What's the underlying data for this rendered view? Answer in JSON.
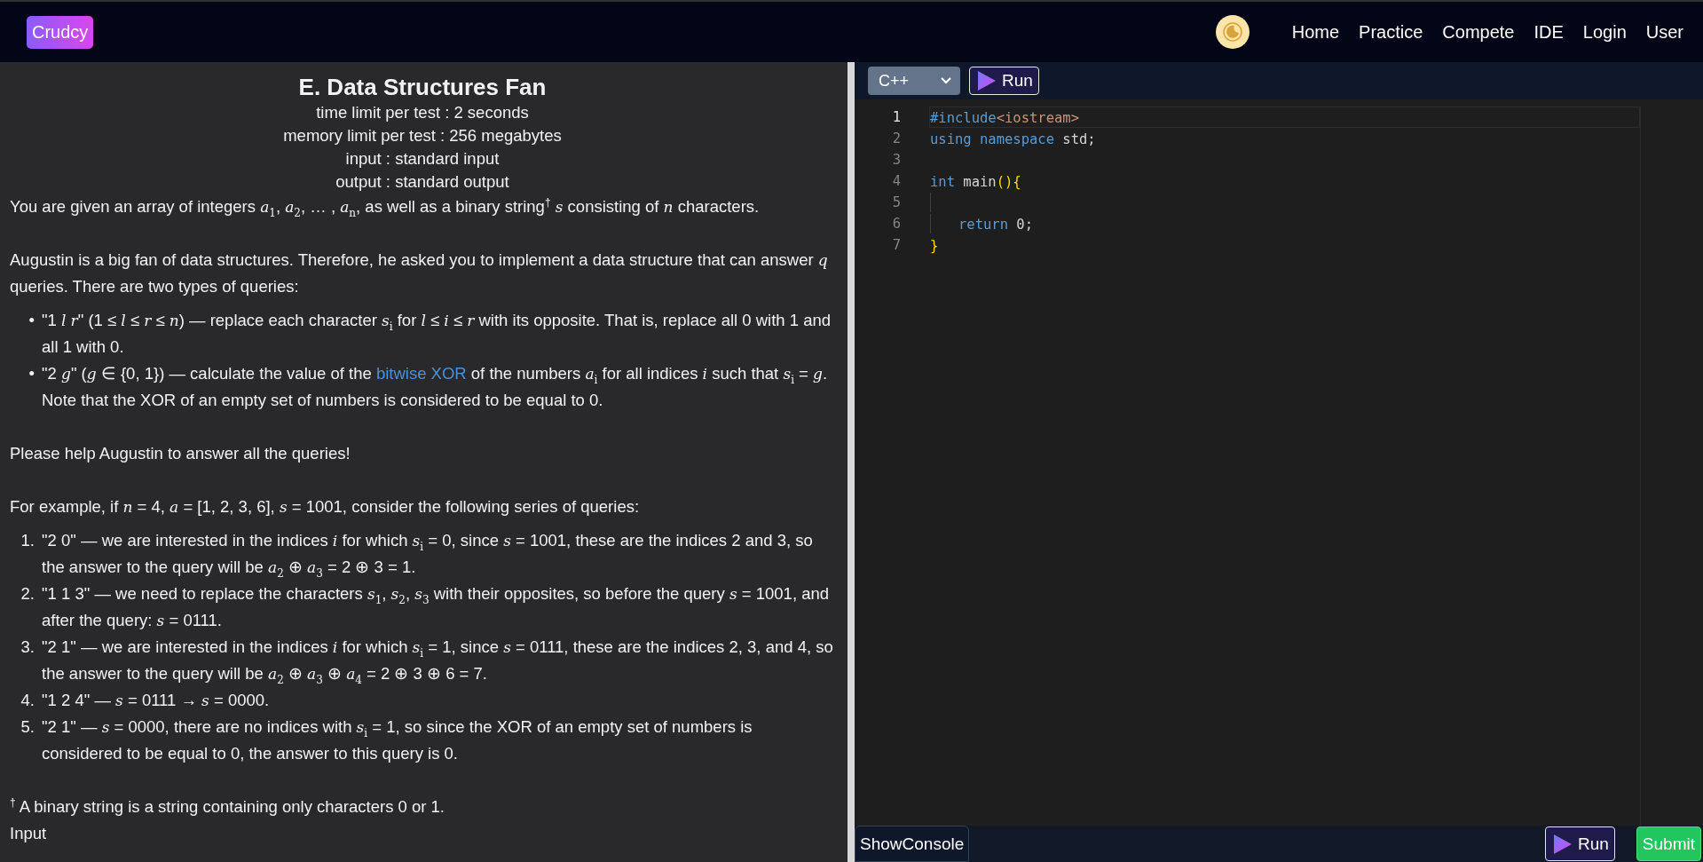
{
  "header": {
    "logo": "Crudcy",
    "nav": [
      {
        "label": "Home"
      },
      {
        "label": "Practice"
      },
      {
        "label": "Compete"
      },
      {
        "label": "IDE"
      },
      {
        "label": "Login"
      },
      {
        "label": "User"
      }
    ]
  },
  "problem": {
    "title": "E. Data Structures Fan",
    "limits": [
      "time limit per test : 2 seconds",
      "memory limit per test : 256 megabytes",
      "input : standard input",
      "output : standard output"
    ],
    "blocks": [
      {
        "kind": "paragraph",
        "parts": [
          {
            "text": "You are given an array of integers *a*$_{1}$, *a*$_{2}$,  … , *a*$_{n}$, as well as a binary string$^{†}$ *s* consisting of *n* characters."
          }
        ]
      },
      {
        "kind": "paragraph",
        "parts": [
          {
            "text": "Augustin is a big fan of data structures. Therefore, he asked you to implement a data structure that can answer *q* queries. There are two types of queries:"
          }
        ]
      },
      {
        "kind": "item",
        "marker": "•",
        "parts": [
          {
            "text": "\"1 *l* *r*\" (1 ≤ *l* ≤ *r* ≤ *n*) — replace each character *s*$_{i}$ for *l* ≤ *i* ≤ *r* with its opposite. That is, replace all 0 with 1 and all 1 with 0."
          }
        ]
      },
      {
        "kind": "item",
        "marker": "•",
        "parts": [
          {
            "text": "\"2 *g*\" (*g* ∈ {0, 1}) — calculate the value of the "
          },
          {
            "kind": "link",
            "text": "bitwise XOR"
          },
          {
            "text": " of the numbers *a*$_{i}$ for all indices *i* such that *s*$_{i}$ = *g*. Note that the XOR of an empty set of numbers is considered to be equal to 0."
          }
        ]
      },
      {
        "kind": "paragraph",
        "parts": [
          {
            "text": "Please help Augustin to answer all the queries!"
          }
        ]
      },
      {
        "kind": "paragraph",
        "parts": [
          {
            "text": "For example, if *n* = 4, *a* = [1, 2, 3, 6], *s* = 1001, consider the following series of queries:"
          }
        ]
      },
      {
        "kind": "item",
        "marker": "1.",
        "parts": [
          {
            "text": "\"2 0\" — we are interested in the indices *i* for which *s*$_{i}$ = 0, since *s* = 1001, these are the indices 2 and 3, so the answer to the query will be *a*$_{2}$ ⊕ *a*$_{3}$ = 2 ⊕ 3 = 1."
          }
        ]
      },
      {
        "kind": "item",
        "marker": "2.",
        "parts": [
          {
            "text": "\"1 1 3\" — we need to replace the characters *s*$_{1}$, *s*$_{2}$, *s*$_{3}$ with their opposites, so before the query *s* = 1001, and after the query: *s* = 0111."
          }
        ]
      },
      {
        "kind": "item",
        "marker": "3.",
        "parts": [
          {
            "text": "\"2 1\" — we are interested in the indices *i* for which *s*$_{i}$ = 1, since *s* = 0111, these are the indices 2, 3, and 4, so the answer to the query will be *a*$_{2}$ ⊕ *a*$_{3}$ ⊕ *a*$_{4}$ = 2 ⊕ 3 ⊕ 6 = 7."
          }
        ]
      },
      {
        "kind": "item",
        "marker": "4.",
        "parts": [
          {
            "text": "\"1 2 4\" — *s* = 0111  →  *s* = 0000."
          }
        ]
      },
      {
        "kind": "item",
        "marker": "5.",
        "parts": [
          {
            "text": "\"2 1\" — *s* = 0000, there are no indices with *s*$_{i}$ = 1, so since the XOR of an empty set of numbers is considered to be equal to 0, the answer to this query is 0."
          }
        ]
      },
      {
        "kind": "paragraph",
        "parts": [
          {
            "text": "$^{†}$ A binary string is a string containing only characters 0 or 1."
          }
        ]
      },
      {
        "kind": "heading",
        "parts": [
          {
            "text": "Input"
          }
        ]
      }
    ]
  },
  "editor": {
    "language": "C++",
    "run_label": "Run",
    "lines": [
      {
        "number": "1",
        "current": true,
        "indented": false,
        "tokens": [
          {
            "kind": "keyword",
            "text": "#include"
          },
          {
            "kind": "string",
            "text": "<iostream>"
          }
        ]
      },
      {
        "number": "2",
        "current": false,
        "indented": false,
        "tokens": [
          {
            "kind": "keyword",
            "text": "using namespace"
          },
          {
            "kind": "plain",
            "text": " std;"
          }
        ]
      },
      {
        "number": "3",
        "current": false,
        "indented": false
      },
      {
        "number": "4",
        "current": false,
        "indented": false,
        "tokens": [
          {
            "kind": "keyword",
            "text": "int"
          },
          {
            "kind": "plain",
            "text": " main"
          },
          {
            "kind": "bracket",
            "text": "(){"
          }
        ]
      },
      {
        "number": "5",
        "current": false,
        "indented": true
      },
      {
        "number": "6",
        "current": false,
        "indented": true,
        "tokens": [
          {
            "kind": "keyword",
            "text": "return"
          },
          {
            "kind": "plain",
            "text": " 0;"
          }
        ]
      },
      {
        "number": "7",
        "current": false,
        "indented": false,
        "tokens": [
          {
            "kind": "bracket",
            "text": "}"
          }
        ]
      }
    ]
  },
  "footer": {
    "console_label": "ShowConsole",
    "run_label": "Run",
    "submit_label": "Submit"
  }
}
